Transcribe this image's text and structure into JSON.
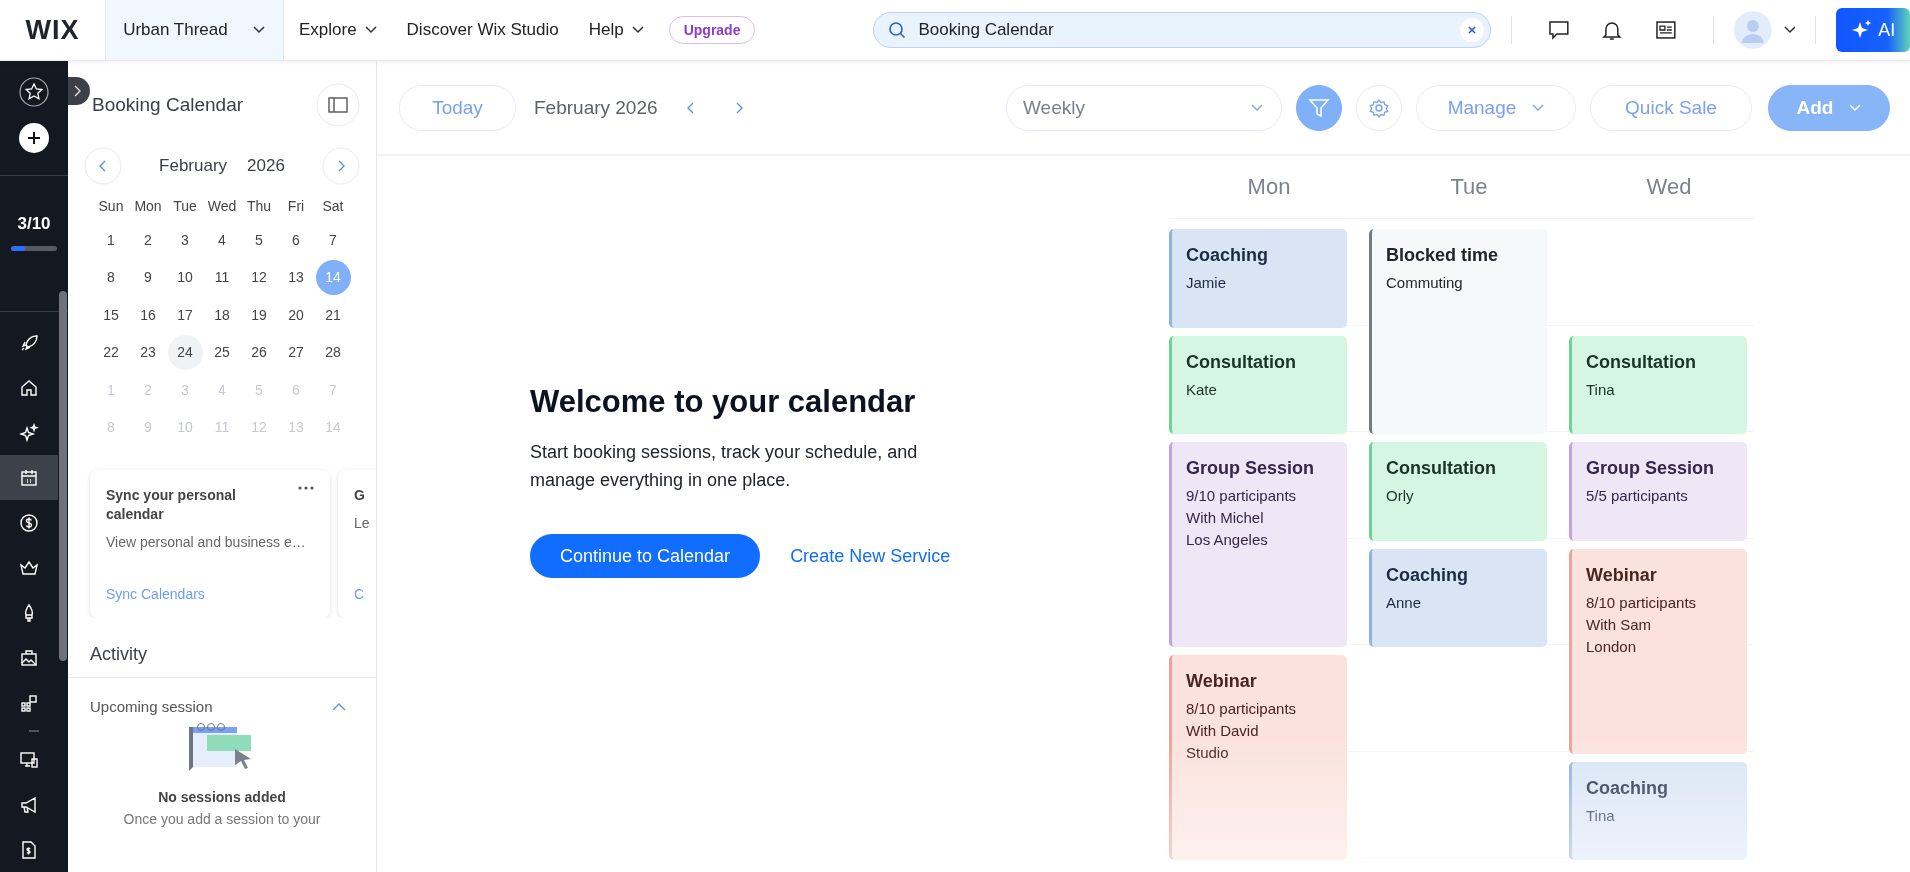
{
  "topbar": {
    "logo": "WIX",
    "site": "Urban Thread",
    "menu": [
      {
        "label": "Explore",
        "dropdown": true
      },
      {
        "label": "Discover Wix Studio",
        "dropdown": false
      },
      {
        "label": "Help",
        "dropdown": true
      }
    ],
    "upgrade": "Upgrade",
    "search": {
      "value": "Booking Calendar"
    },
    "ai": "AI"
  },
  "rail": {
    "progress": {
      "text": "3/10",
      "level": 0.3
    },
    "items": [
      {
        "selected": false
      },
      {
        "selected": false
      },
      {
        "selected": false
      },
      {
        "selected": true
      },
      {
        "selected": false
      },
      {
        "selected": false
      },
      {
        "selected": false
      },
      {
        "selected": false
      },
      {
        "selected": false
      },
      {
        "selected": false
      },
      {
        "selected": false
      },
      {
        "selected": false
      }
    ]
  },
  "panel": {
    "title": "Booking Calendar",
    "month": "February",
    "year": "2026",
    "weekdays": [
      "Sun",
      "Mon",
      "Tue",
      "Wed",
      "Thu",
      "Fri",
      "Sat"
    ],
    "weeks": [
      [
        {
          "label": "1",
          "selected": false,
          "outside": false,
          "highlighted": false
        },
        {
          "label": "2",
          "selected": false,
          "outside": false,
          "highlighted": false
        },
        {
          "label": "3",
          "selected": false,
          "outside": false,
          "highlighted": false
        },
        {
          "label": "4",
          "selected": false,
          "outside": false,
          "highlighted": false
        },
        {
          "label": "5",
          "selected": false,
          "outside": false,
          "highlighted": false
        },
        {
          "label": "6",
          "selected": false,
          "outside": false,
          "highlighted": false
        },
        {
          "label": "7",
          "selected": false,
          "outside": false,
          "highlighted": false
        }
      ],
      [
        {
          "label": "8",
          "selected": false,
          "outside": false,
          "highlighted": false
        },
        {
          "label": "9",
          "selected": false,
          "outside": false,
          "highlighted": false
        },
        {
          "label": "10",
          "selected": false,
          "outside": false,
          "highlighted": false
        },
        {
          "label": "11",
          "selected": false,
          "outside": false,
          "highlighted": false
        },
        {
          "label": "12",
          "selected": false,
          "outside": false,
          "highlighted": false
        },
        {
          "label": "13",
          "selected": false,
          "outside": false,
          "highlighted": false
        },
        {
          "label": "14",
          "selected": true,
          "outside": false,
          "highlighted": false
        }
      ],
      [
        {
          "label": "15",
          "selected": false,
          "outside": false,
          "highlighted": false
        },
        {
          "label": "16",
          "selected": false,
          "outside": false,
          "highlighted": false
        },
        {
          "label": "17",
          "selected": false,
          "outside": false,
          "highlighted": false
        },
        {
          "label": "18",
          "selected": false,
          "outside": false,
          "highlighted": false
        },
        {
          "label": "19",
          "selected": false,
          "outside": false,
          "highlighted": false
        },
        {
          "label": "20",
          "selected": false,
          "outside": false,
          "highlighted": false
        },
        {
          "label": "21",
          "selected": false,
          "outside": false,
          "highlighted": false
        }
      ],
      [
        {
          "label": "22",
          "selected": false,
          "outside": false,
          "highlighted": false
        },
        {
          "label": "23",
          "selected": false,
          "outside": false,
          "highlighted": false
        },
        {
          "label": "24",
          "selected": false,
          "outside": false,
          "highlighted": true
        },
        {
          "label": "25",
          "selected": false,
          "outside": false,
          "highlighted": false
        },
        {
          "label": "26",
          "selected": false,
          "outside": false,
          "highlighted": false
        },
        {
          "label": "27",
          "selected": false,
          "outside": false,
          "highlighted": false
        },
        {
          "label": "28",
          "selected": false,
          "outside": false,
          "highlighted": false
        }
      ],
      [
        {
          "label": "1",
          "selected": false,
          "outside": true,
          "highlighted": false
        },
        {
          "label": "2",
          "selected": false,
          "outside": true,
          "highlighted": false
        },
        {
          "label": "3",
          "selected": false,
          "outside": true,
          "highlighted": false
        },
        {
          "label": "4",
          "selected": false,
          "outside": true,
          "highlighted": false
        },
        {
          "label": "5",
          "selected": false,
          "outside": true,
          "highlighted": false
        },
        {
          "label": "6",
          "selected": false,
          "outside": true,
          "highlighted": false
        },
        {
          "label": "7",
          "selected": false,
          "outside": true,
          "highlighted": false
        }
      ],
      [
        {
          "label": "8",
          "selected": false,
          "outside": true,
          "highlighted": false
        },
        {
          "label": "9",
          "selected": false,
          "outside": true,
          "highlighted": false
        },
        {
          "label": "10",
          "selected": false,
          "outside": true,
          "highlighted": false
        },
        {
          "label": "11",
          "selected": false,
          "outside": true,
          "highlighted": false
        },
        {
          "label": "12",
          "selected": false,
          "outside": true,
          "highlighted": false
        },
        {
          "label": "13",
          "selected": false,
          "outside": true,
          "highlighted": false
        },
        {
          "label": "14",
          "selected": false,
          "outside": true,
          "highlighted": false
        }
      ]
    ],
    "cards": [
      {
        "title": "Sync your personal calendar",
        "text": "View personal and business e…",
        "link": "Sync Calendars"
      },
      {
        "title": "G",
        "text": "Le",
        "link": "C"
      }
    ],
    "activity": "Activity",
    "upcoming": "Upcoming session",
    "empty_title": "No sessions added",
    "empty_text": "Once you add a session to your"
  },
  "toolbar": {
    "today": "Today",
    "period": "February 2026",
    "view": "Weekly",
    "filter_active": true,
    "manage": "Manage",
    "quick_sale": "Quick Sale",
    "add": "Add"
  },
  "welcome": {
    "title": "Welcome to your calendar",
    "text": "Start booking sessions, track your schedule, and manage everything in one place.",
    "primary": "Continue to Calendar",
    "secondary": "Create New Service"
  },
  "week": {
    "days": [
      "Mon",
      "Tue",
      "Wed"
    ],
    "events": [
      {
        "kind": "coaching",
        "title": "Coaching",
        "lines": [
          "Jamie"
        ]
      },
      {
        "kind": "consultation",
        "title": "Consultation",
        "lines": [
          "Kate"
        ]
      },
      {
        "kind": "group",
        "title": "Group Session",
        "lines": [
          "9/10 participants",
          "With Michel",
          "Los Angeles"
        ]
      },
      {
        "kind": "webinar",
        "title": "Webinar",
        "lines": [
          "8/10 participants",
          "With David",
          "Studio"
        ]
      },
      {
        "kind": "blocked",
        "title": "Blocked time",
        "lines": [
          "Commuting"
        ]
      },
      {
        "kind": "consultation",
        "title": "Consultation",
        "lines": [
          "Orly"
        ]
      },
      {
        "kind": "coaching",
        "title": "Coaching",
        "lines": [
          "Anne"
        ]
      },
      {
        "kind": "consultation",
        "title": "Consultation",
        "lines": [
          "Tina"
        ]
      },
      {
        "kind": "group",
        "title": "Group Session",
        "lines": [
          "5/5 participants"
        ]
      },
      {
        "kind": "webinar",
        "title": "Webinar",
        "lines": [
          "8/10 participants",
          "With Sam",
          "London"
        ]
      },
      {
        "kind": "coaching",
        "title": "Coaching",
        "lines": [
          "Tina"
        ]
      }
    ]
  }
}
